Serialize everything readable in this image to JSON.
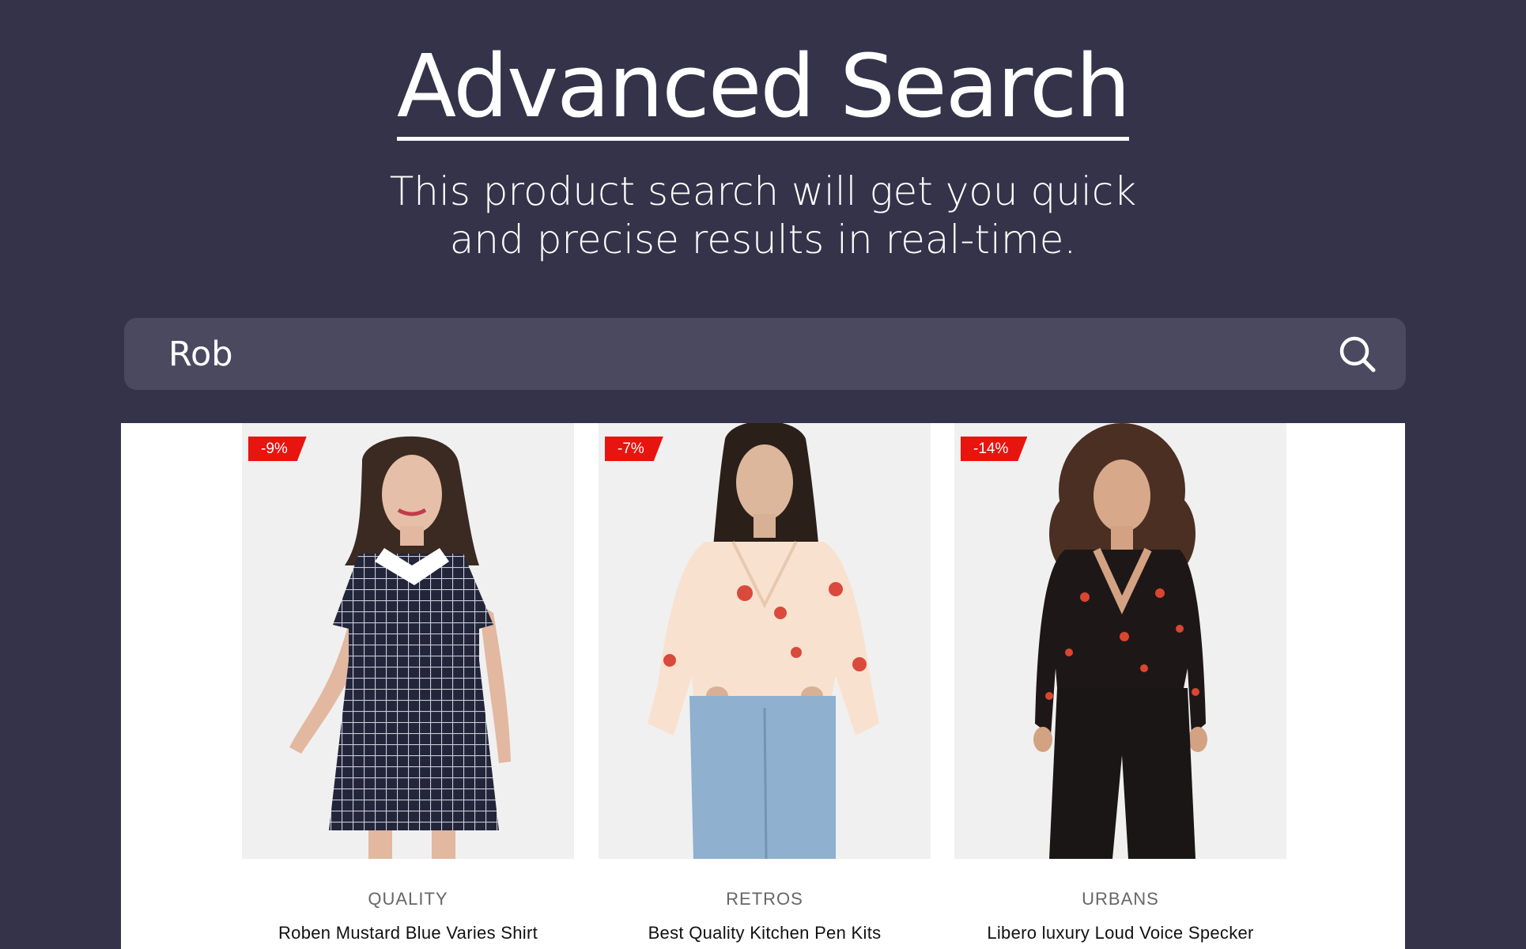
{
  "hero": {
    "title": "Advanced Search",
    "subtitle_line1": "This product search will get you quick",
    "subtitle_line2": "and precise results in real-time."
  },
  "search": {
    "value": "Rob",
    "button_icon": "search-icon"
  },
  "products": [
    {
      "badge": "-9%",
      "category": "QUALITY",
      "name": "Roben Mustard Blue Varies Shirt",
      "image": "woman-checked-dress"
    },
    {
      "badge": "-7%",
      "category": "RETROS",
      "name": "Best Quality Kitchen Pen Kits",
      "image": "woman-floral-blouse-jeans"
    },
    {
      "badge": "-14%",
      "category": "URBANS",
      "name": "Libero luxury Loud Voice Specker",
      "image": "woman-black-floral-wrap-top"
    }
  ],
  "colors": {
    "page_background": "#35334a",
    "search_bar": "#4a4960",
    "badge": "#e8140f",
    "image_background": "#f0f0f0"
  }
}
